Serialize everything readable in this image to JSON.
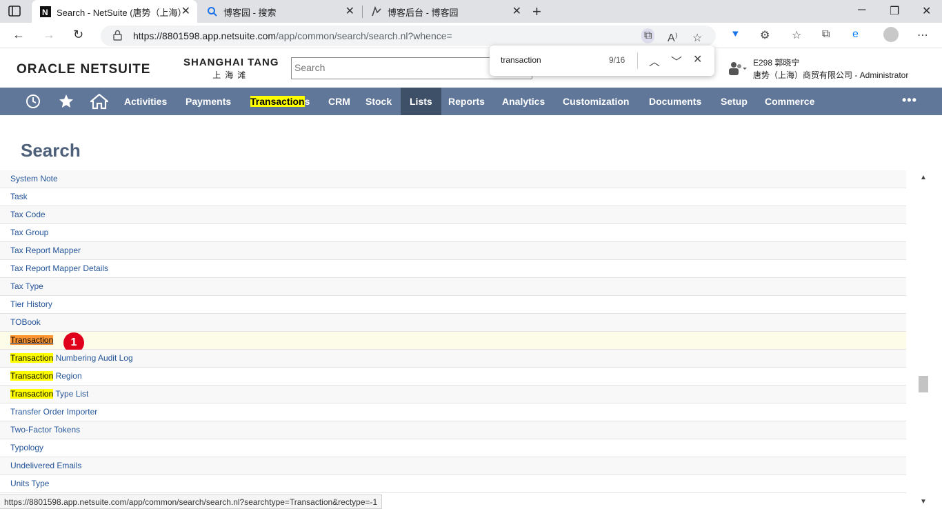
{
  "browser": {
    "tabs": [
      {
        "title": "Search - NetSuite (唐势（上海）",
        "active": true
      },
      {
        "title": "博客园 - 搜索",
        "active": false
      },
      {
        "title": "博客后台 - 博客园",
        "active": false
      }
    ],
    "url_host": "https://8801598.app.netsuite.com",
    "url_path": "/app/common/search/search.nl?whence="
  },
  "find": {
    "query": "transaction",
    "count": "9/16"
  },
  "header": {
    "logo": "ORACLE NETSUITE",
    "brand_line1": "SHANGHAI TANG",
    "brand_line2": "上海滩",
    "search_placeholder": "Search",
    "user_line1": "E298 郭晓宁",
    "user_line2": "唐势（上海）商贸有限公司 - Administrator"
  },
  "nav": {
    "items": [
      "Activities",
      "Payments",
      "Transactions",
      "CRM",
      "Stock",
      "Lists",
      "Reports",
      "Analytics",
      "Customization",
      "Documents",
      "Setup",
      "Commerce"
    ],
    "transactions_hl": "Transaction",
    "transactions_rest": "s",
    "active": "Lists"
  },
  "page": {
    "title": "Search",
    "rows": [
      {
        "hl": "",
        "text": "System Note"
      },
      {
        "hl": "",
        "text": "Task"
      },
      {
        "hl": "",
        "text": "Tax Code"
      },
      {
        "hl": "",
        "text": "Tax Group"
      },
      {
        "hl": "",
        "text": "Tax Report Mapper"
      },
      {
        "hl": "",
        "text": "Tax Report Mapper Details"
      },
      {
        "hl": "",
        "text": "Tax Type"
      },
      {
        "hl": "",
        "text": "Tier History"
      },
      {
        "hl": "",
        "text": "TOBook"
      },
      {
        "hl": "Transaction",
        "text": "",
        "current": true
      },
      {
        "hl": "Transaction",
        "text": " Numbering Audit Log"
      },
      {
        "hl": "Transaction",
        "text": " Region"
      },
      {
        "hl": "Transaction",
        "text": " Type List"
      },
      {
        "hl": "",
        "text": "Transfer Order Importer"
      },
      {
        "hl": "",
        "text": "Two-Factor Tokens"
      },
      {
        "hl": "",
        "text": "Typology"
      },
      {
        "hl": "",
        "text": "Undelivered Emails"
      },
      {
        "hl": "",
        "text": "Units Type"
      }
    ],
    "badge": "1"
  },
  "status_url": "https://8801598.app.netsuite.com/app/common/search/search.nl?searchtype=Transaction&rectype=-1",
  "colors": {
    "nav_bg": "#607799",
    "nav_active": "#3e4f68",
    "highlight": "#ffff00",
    "current_match": "#ff9632",
    "link": "#255599"
  }
}
